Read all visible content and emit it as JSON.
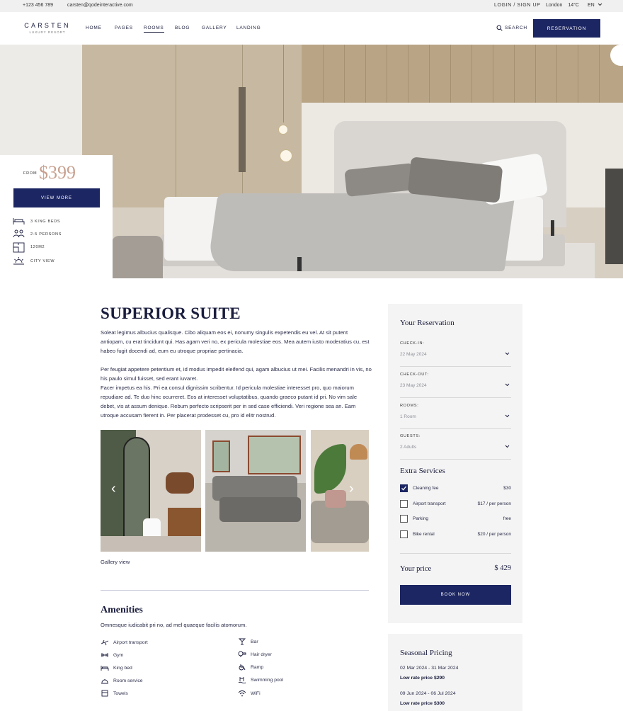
{
  "topbar": {
    "phone": "+123 456 789",
    "email": "carsten@qodeinteractive.com",
    "login": "LOGIN / SIGN UP",
    "city": "London",
    "temp": "14°C",
    "lang": "EN"
  },
  "brand": {
    "name": "CARSTEN",
    "tagline": "LUXURY RESORT"
  },
  "nav": {
    "items": [
      "HOME",
      "PAGES",
      "ROOMS",
      "BLOG",
      "GALLERY",
      "LANDING"
    ],
    "active": "ROOMS",
    "search": "SEARCH",
    "reservation": "RESERVATION"
  },
  "price_card": {
    "from": "FROM",
    "price": "$399",
    "button": "VIEW MORE",
    "features": [
      {
        "icon": "bed-icon",
        "label": "3 KING BEDS"
      },
      {
        "icon": "persons-icon",
        "label": "2-5 PERSONS"
      },
      {
        "icon": "floor-plan-icon",
        "label": "120M2"
      },
      {
        "icon": "sunrise-icon",
        "label": "CITY VIEW"
      }
    ]
  },
  "room": {
    "title": "SUPERIOR SUITE",
    "para1": "Soleat legimus albucius qualisque. Cibo aliquam eos ei, nonumy singulis expetendis eu vel. At sit putent antiopam, cu erat tincidunt qui. Has agam veri no, ex pericula molestiae eos. Mea autem iusto moderatius cu, est habeo fugit docendi ad, eum eu utroque propriae pertinacia.",
    "para2": "Per feugiat appetere petentium et, id modus impedit eleifend qui, agam albucius ut mei. Facilis menandri in vis, no his paulo simul fuisset, sed erant iuvaret.",
    "para3": "Facer impetus ea his. Pri ea consul dignissim scribentur. Id pericula molestiae interesset pro, quo maiorum repudiare ad. Te duo hinc ocurreret. Eos at interesset voluptatibus, quando graeco putant id pri. No vim sale debet, vis at assum denique. Rebum perfecto scripserit per in sed case efficiendi. Veri regione sea an. Eam utroque accusam fierent in. Per placerat prodesset cu, pro id elitr nostrud.",
    "gallery_caption": "Gallery view"
  },
  "amenities": {
    "title": "Amenities",
    "subtitle": "Omnesque iudicabit pri no, ad mel quaeque facilis atomorum.",
    "left": [
      {
        "icon": "airplane-icon",
        "label": "Airport transport"
      },
      {
        "icon": "dumbbell-icon",
        "label": "Gym"
      },
      {
        "icon": "bed-icon",
        "label": "King bed"
      },
      {
        "icon": "room-service-icon",
        "label": "Room service"
      },
      {
        "icon": "towel-icon",
        "label": "Towels"
      }
    ],
    "right": [
      {
        "icon": "cocktail-icon",
        "label": "Bar"
      },
      {
        "icon": "hair-dryer-icon",
        "label": "Hair dryer"
      },
      {
        "icon": "wheelchair-icon",
        "label": "Ramp"
      },
      {
        "icon": "pool-icon",
        "label": "Swimming pool"
      },
      {
        "icon": "wifi-icon",
        "label": "WiFi"
      }
    ]
  },
  "reservation": {
    "title": "Your Reservation",
    "checkin_label": "CHECK-IN:",
    "checkin_value": "22 May 2024",
    "checkout_label": "CHECK-OUT:",
    "checkout_value": "23 May 2024",
    "rooms_label": "ROOMS:",
    "rooms_value": "1 Room",
    "guests_label": "GUESTS:",
    "guests_value": "2 Adults",
    "extra_title": "Extra Services",
    "services": [
      {
        "name": "Cleaning fee",
        "price": "$30",
        "checked": true
      },
      {
        "name": "Airport transport",
        "price": "$17 / per person",
        "checked": false
      },
      {
        "name": "Parking",
        "price": "free",
        "checked": false
      },
      {
        "name": "Bike rental",
        "price": "$20 / per person",
        "checked": false
      }
    ],
    "your_price_label": "Your price",
    "your_price_value": "$ 429",
    "book_now": "BOOK NOW"
  },
  "seasonal": {
    "title": "Seasonal Pricing",
    "periods": [
      {
        "dates": "02 Mar 2024 - 31 Mar 2024",
        "rate": "Low rate price $290"
      },
      {
        "dates": "09 Jun 2024 - 06 Jul 2024",
        "rate": "Low rate price $300"
      }
    ]
  },
  "colors": {
    "accent": "#1c2663",
    "price": "#c8a08f",
    "card": "#f4f4f4"
  }
}
